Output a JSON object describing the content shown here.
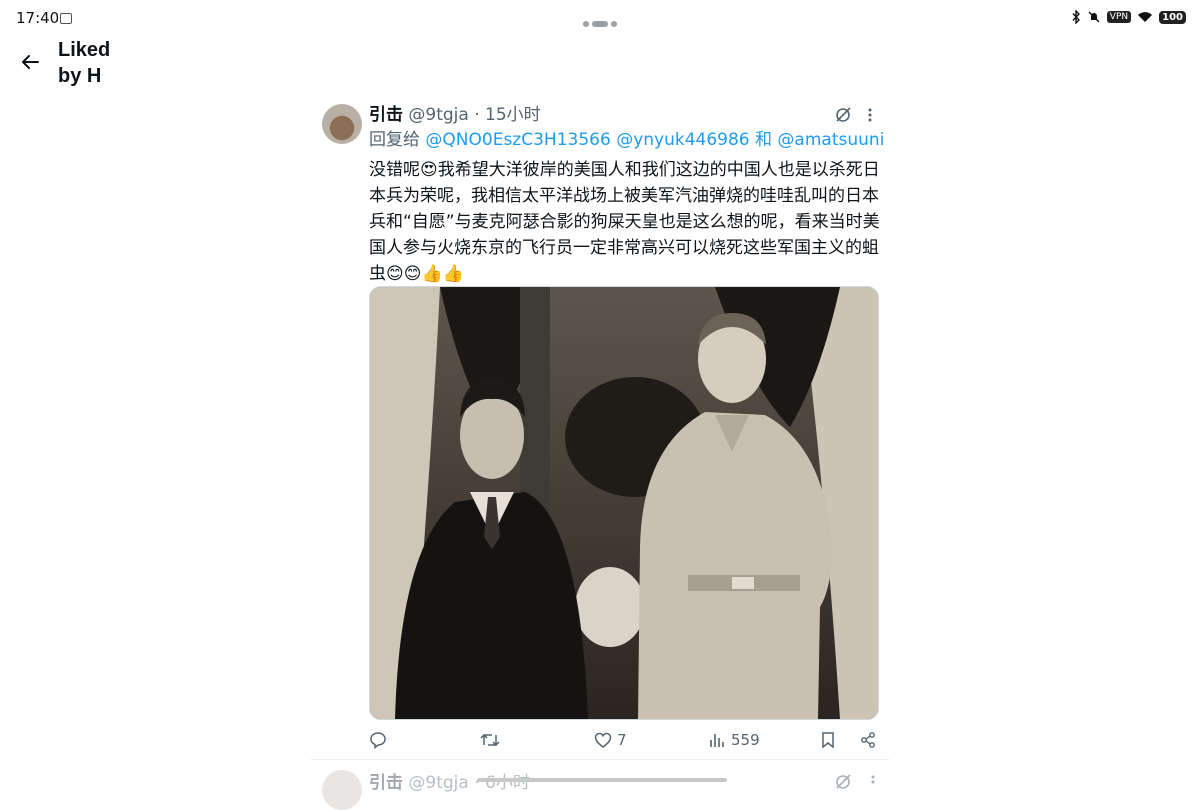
{
  "status_bar": {
    "time": "17:40",
    "vpn": "VPN",
    "battery": "100"
  },
  "header": {
    "title": "Liked by H"
  },
  "tweet": {
    "name": "引击",
    "handle": "@9tgja",
    "separator": "·",
    "time": "15小时",
    "reply_prefix": "回复给",
    "mention_1": "@QNO0EszC3H13566",
    "mention_2": "@ynyuk446986",
    "reply_and": "和",
    "mention_3": "@amatsuuni",
    "text": "没错呢😍我希望大洋彼岸的美国人和我们这边的中国人也是以杀死日本兵为荣呢，我相信太平洋战场上被美军汽油弹烧的哇哇乱叫的日本兵和“自愿”与麦克阿瑟合影的狗屎天皇也是这么想的呢，看来当时美国人参与火烧东京的飞行员一定非常高兴可以烧死这些军国主义的蛆虫😊😊👍👍",
    "actions": {
      "reply_count": "",
      "retweet_count": "",
      "like_count": "7",
      "views_count": "559"
    }
  },
  "next_tweet": {
    "name": "引击",
    "handle": "@9tgja",
    "separator": "·",
    "time": "6小时"
  },
  "colors": {
    "accent": "#1d9bf0",
    "secondary_text": "#536471",
    "primary_text": "#0f1419"
  }
}
